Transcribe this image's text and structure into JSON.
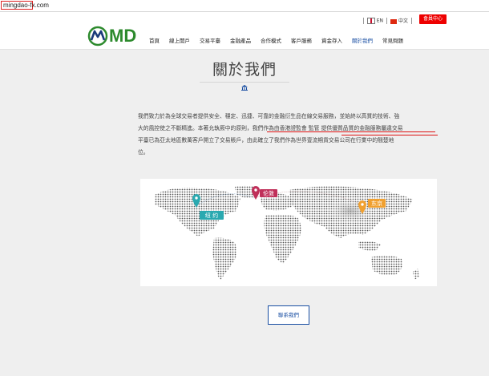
{
  "url": "mingdao-fx.com",
  "header": {
    "lang_en": "EN",
    "lang_zh": "中文",
    "member_button": "會員中心",
    "logo_text": "MD",
    "nav": [
      "首頁",
      "線上開戶",
      "交易平臺",
      "金融產品",
      "合作模式",
      "客戶服務",
      "資金存入",
      "關於我們",
      "常見問題"
    ],
    "active_nav": 7
  },
  "page": {
    "title": "關於我們",
    "paragraph_lines": [
      "我們致力於為全球交易者提供安全、穩定、迅捷、可靠的金融衍生品在線交易服務，並始終以高質的技術、強",
      "大的風控使之不斷精進。本著允執厥中的原則，我們作為由香港證監會 監管 提供優質品質的金融服務屬違交易",
      "平臺已為亞太地區數萬客戶開立了交易賬戶，由此確立了我們作為世界壹流期貨交易公司在行業中的翹楚地",
      "位。"
    ],
    "contact_button": "聯系我們"
  },
  "map": {
    "labels": {
      "london": "伦敦",
      "newyork": "纽 约",
      "tokyo": "东京"
    },
    "colors": {
      "london": "#c0305a",
      "newyork": "#2aa9b0",
      "tokyo": "#f0a030",
      "dots": "#555555"
    }
  }
}
